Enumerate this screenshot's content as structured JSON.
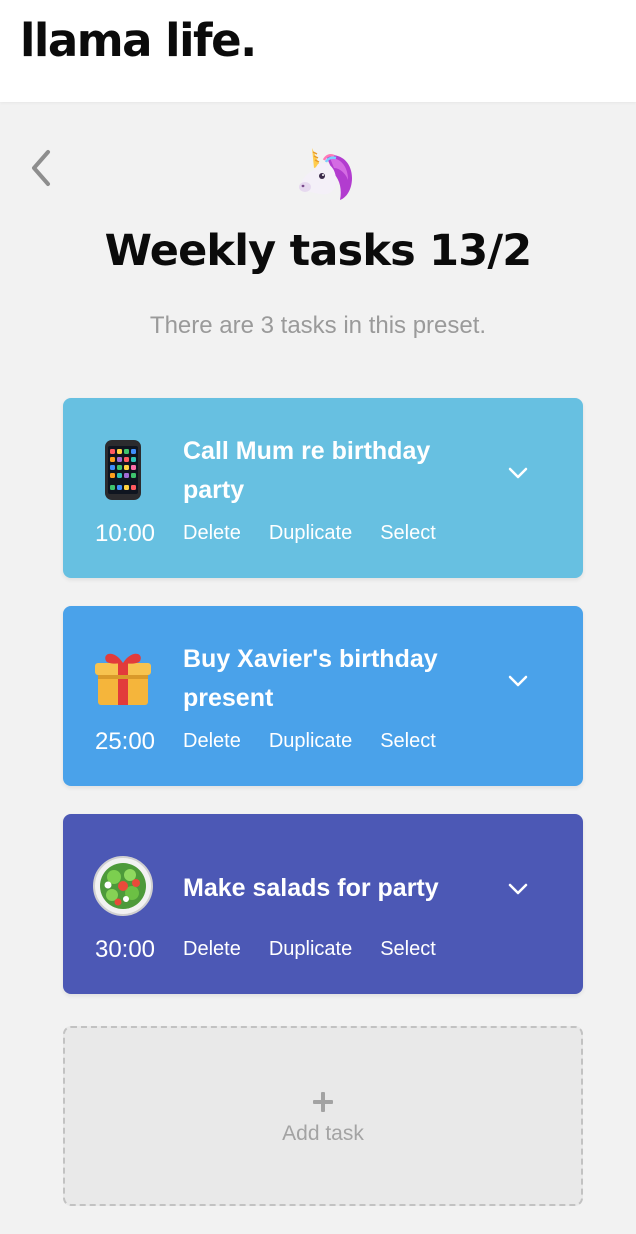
{
  "app": {
    "brand": "llama life."
  },
  "nav": {
    "back_icon": "chevron-left-icon"
  },
  "preset": {
    "emoji_icon": "unicorn-icon",
    "title": "Weekly tasks 13/2",
    "subtitle": "There are 3 tasks in this preset."
  },
  "tasks": [
    {
      "title": "Call Mum re birthday party",
      "emoji_icon": "mobile-phone-icon",
      "time": "10:00",
      "color": "#67c0e1",
      "actions": [
        "Delete",
        "Duplicate",
        "Select"
      ]
    },
    {
      "title": "Buy Xavier's birthday present",
      "emoji_icon": "gift-icon",
      "time": "25:00",
      "color": "#4aa2ea",
      "actions": [
        "Delete",
        "Duplicate",
        "Select"
      ]
    },
    {
      "title": "Make salads for party",
      "emoji_icon": "salad-icon",
      "time": "30:00",
      "color": "#4c58b5",
      "actions": [
        "Delete",
        "Duplicate",
        "Select"
      ]
    }
  ],
  "add_task": {
    "label": "Add task",
    "icon": "plus-icon"
  }
}
